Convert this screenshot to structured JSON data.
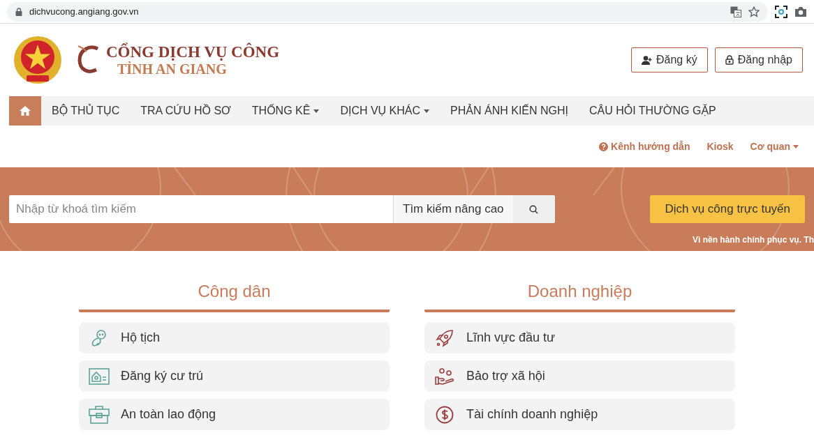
{
  "browser": {
    "url": "dichvucong.angiang.gov.vn"
  },
  "header": {
    "logo_title": "CỔNG DỊCH VỤ CÔNG",
    "logo_subtitle": "TỈNH AN GIANG",
    "buttons": [
      {
        "kind": "register",
        "label": "Đăng ký"
      },
      {
        "kind": "login",
        "label": "Đăng nhập"
      }
    ]
  },
  "nav": {
    "home_selected": true,
    "items": [
      {
        "label": "BỘ THỦ TỤC",
        "dropdown": false
      },
      {
        "label": "TRA CỨU HỒ SƠ",
        "dropdown": false
      },
      {
        "label": "THỐNG KÊ",
        "dropdown": true
      },
      {
        "label": "DỊCH VỤ KHÁC",
        "dropdown": true
      },
      {
        "label": "PHẢN ÁNH KIẾN NGHỊ",
        "dropdown": false
      },
      {
        "label": "CÂU HỎI THƯỜNG GẶP",
        "dropdown": false
      }
    ]
  },
  "sub_links": [
    {
      "label": "Kênh hướng dẫn",
      "kind": "help"
    },
    {
      "label": "Kiosk",
      "kind": "plain"
    },
    {
      "label": "Cơ quan",
      "kind": "dropdown"
    }
  ],
  "search": {
    "placeholder": "Nhập từ khoá tìm kiếm",
    "advanced": "Tìm kiếm nâng cao",
    "online_button": "Dịch vụ công trực tuyến"
  },
  "ticker": "Vì nền hành chính phục vụ. Th",
  "sections": [
    {
      "title": "Công dân",
      "items": [
        {
          "label": "Hộ tịch"
        },
        {
          "label": "Đăng ký cư trú"
        },
        {
          "label": "An toàn lao động"
        }
      ]
    },
    {
      "title": "Doanh nghiệp",
      "items": [
        {
          "label": "Lĩnh vực đầu tư"
        },
        {
          "label": "Bảo trợ xã hội"
        },
        {
          "label": "Tài chính doanh nghiệp"
        }
      ]
    }
  ]
}
